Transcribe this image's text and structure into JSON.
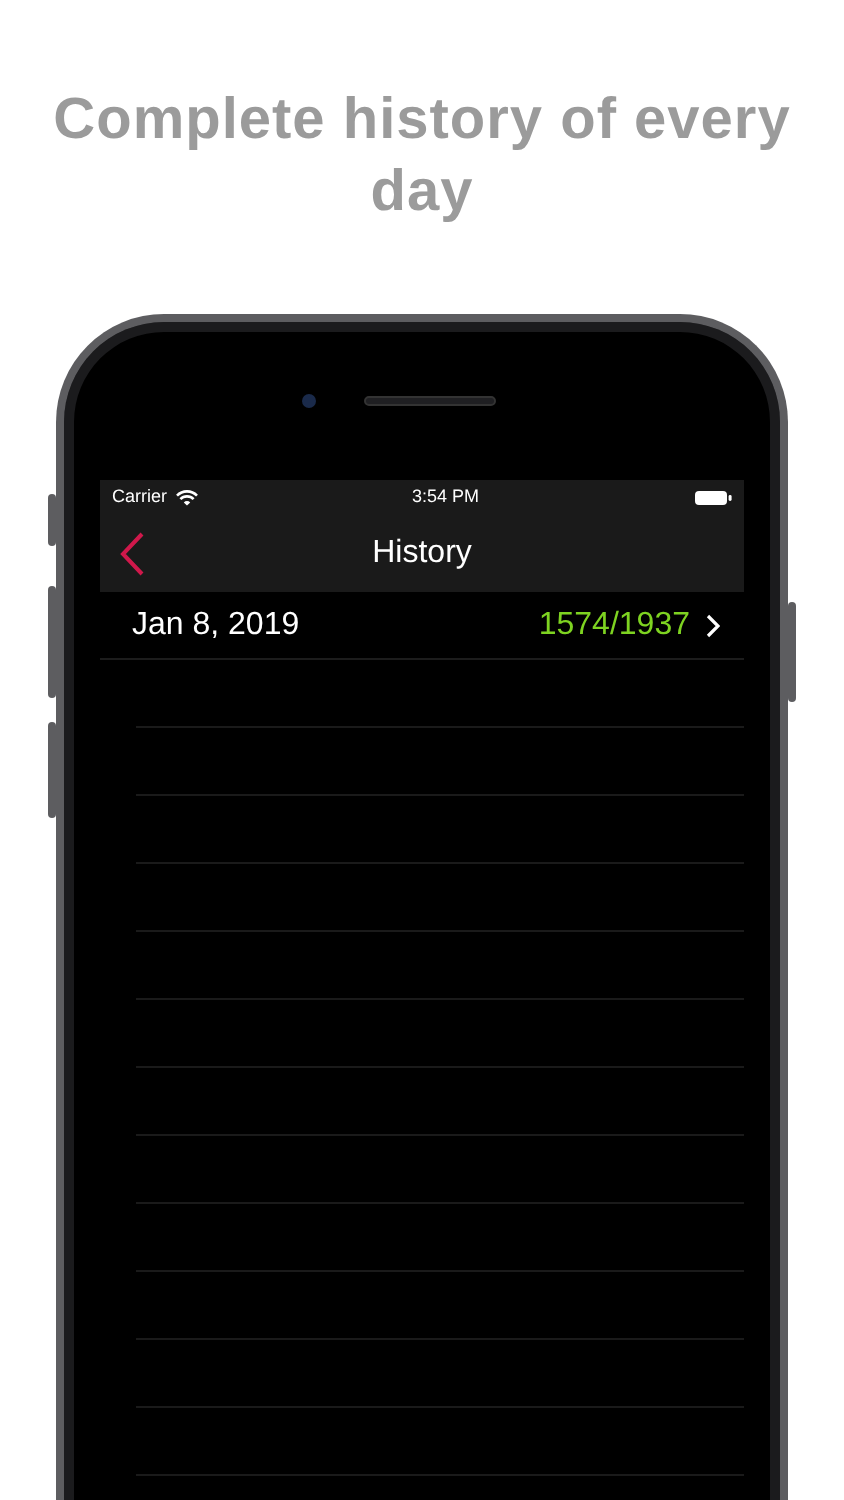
{
  "headline": "Complete history of every day",
  "status_bar": {
    "carrier": "Carrier",
    "time": "3:54 PM"
  },
  "nav_bar": {
    "title": "History"
  },
  "rows": [
    {
      "date": "Jan 8, 2019",
      "count": "1574/1937"
    }
  ]
}
